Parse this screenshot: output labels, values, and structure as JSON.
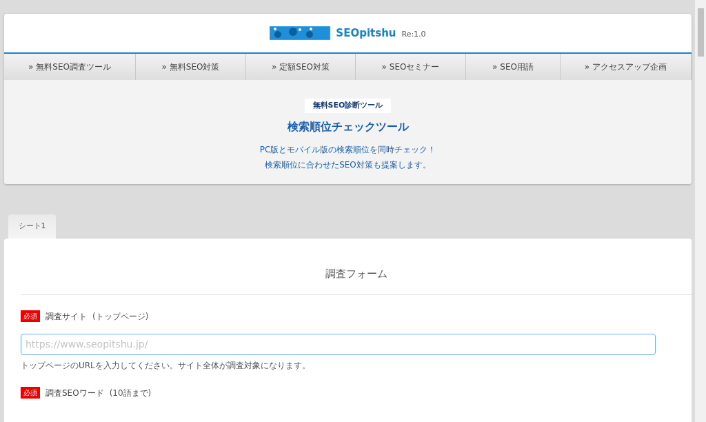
{
  "header": {
    "logo_text": "SEOpitshu",
    "version": "Re:1.0"
  },
  "nav": [
    {
      "icon": "»",
      "label": "無料SEO調査ツール"
    },
    {
      "icon": "»",
      "label": "無料SEO対策"
    },
    {
      "icon": "»",
      "label": "定額SEO対策"
    },
    {
      "icon": "»",
      "label": "SEOセミナー"
    },
    {
      "icon": "»",
      "label": "SEO用語"
    },
    {
      "icon": "»",
      "label": "アクセスアップ企画"
    }
  ],
  "hero": {
    "badge": "無料SEO診断ツール",
    "title": "検索順位チェックツール",
    "lines": [
      "PC版とモバイル版の検索順位を同時チェック！",
      "検索順位に合わせたSEO対策も提案します。"
    ]
  },
  "tabs": [
    {
      "label": "シート1",
      "selected": true
    }
  ],
  "form": {
    "title": "調査フォーム",
    "fields": [
      {
        "required_badge": "必須",
        "label": "調査サイト",
        "note": "(トップページ)",
        "placeholder": "https://www.seopitshu.jp/",
        "help": "トップページのURLを入力してください。サイト全体が調査対象になります。"
      },
      {
        "required_badge": "必須",
        "label": "調査SEOワード",
        "note": "(10語まで)"
      }
    ]
  }
}
